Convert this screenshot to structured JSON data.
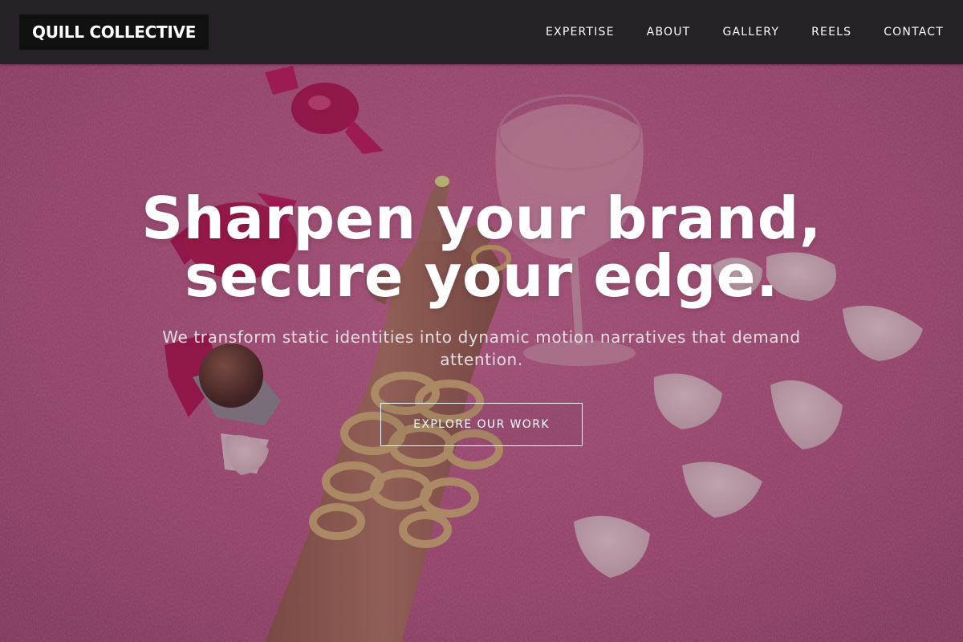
{
  "header": {
    "logo_text": "QUILL COLLECTIVE",
    "nav": [
      {
        "label": "EXPERTISE"
      },
      {
        "label": "ABOUT"
      },
      {
        "label": "GALLERY"
      },
      {
        "label": "REELS"
      },
      {
        "label": "CONTACT"
      }
    ]
  },
  "hero": {
    "title_line1": "Sharpen your brand,",
    "title_line2": "secure your edge.",
    "subtitle": "We transform static identities into dynamic motion narratives that demand attention.",
    "cta_label": "EXPLORE OUR WORK",
    "background_image": "pink fur rug with wrapped candies, chocolate truffle, cocktail glass, white petals and a hand wearing gold chain bracelets"
  },
  "colors": {
    "navbar_bg": "#232125",
    "logo_bg": "#111111",
    "text": "#ffffff",
    "hero_tint": "#b0507a"
  }
}
